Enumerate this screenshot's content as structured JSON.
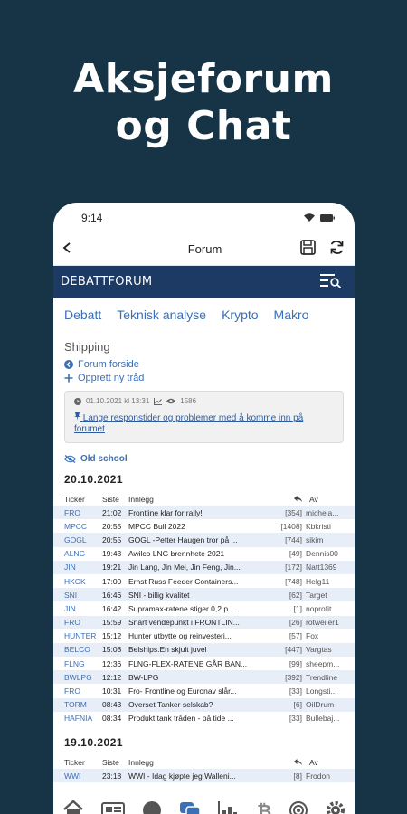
{
  "headline": {
    "line1": "Aksjeforum",
    "line2": "og Chat"
  },
  "status": {
    "time": "9:14"
  },
  "appbar": {
    "title": "Forum"
  },
  "banner": {
    "title": "DEBATTFORUM"
  },
  "tabs": [
    "Debatt",
    "Teknisk analyse",
    "Krypto",
    "Makro"
  ],
  "section": {
    "title": "Shipping",
    "forum_home": "Forum forside",
    "new_thread": "Opprett ny tråd"
  },
  "notice": {
    "date": "01.10.2021 kl 13:31",
    "views": "1586",
    "link": "Lange responstider og problemer med å komme inn på forumet"
  },
  "oldschool": {
    "label": "Old school"
  },
  "columns": {
    "ticker": "Ticker",
    "last": "Siste",
    "post": "Innlegg",
    "by": "Av"
  },
  "groups": [
    {
      "date": "20.10.2021",
      "rows": [
        {
          "ticker": "FRO",
          "time": "21:02",
          "post": "Frontline klar for rally!",
          "count": "[354]",
          "author": "michela..."
        },
        {
          "ticker": "MPCC",
          "time": "20:55",
          "post": "MPCC Bull 2022",
          "count": "[1408]",
          "author": "Kbkristi"
        },
        {
          "ticker": "GOGL",
          "time": "20:55",
          "post": "GOGL -Petter Haugen tror på ...",
          "count": "[744]",
          "author": "sikim"
        },
        {
          "ticker": "ALNG",
          "time": "19:43",
          "post": "Awilco LNG brennhete 2021",
          "count": "[49]",
          "author": "Dennis00"
        },
        {
          "ticker": "JIN",
          "time": "19:21",
          "post": "Jin Lang, Jin Mei, Jin Feng, Jin...",
          "count": "[172]",
          "author": "Natt1369"
        },
        {
          "ticker": "HKCK",
          "time": "17:00",
          "post": "Ernst Russ Feeder Containers...",
          "count": "[748]",
          "author": "Helg11"
        },
        {
          "ticker": "SNI",
          "time": "16:46",
          "post": "SNI - billig kvalitet",
          "count": "[62]",
          "author": "Target"
        },
        {
          "ticker": "JIN",
          "time": "16:42",
          "post": "Supramax-ratene stiger 0,2 p...",
          "count": "[1]",
          "author": "noprofit"
        },
        {
          "ticker": "FRO",
          "time": "15:59",
          "post": "Snart vendepunkt i FRONTLIN...",
          "count": "[26]",
          "author": "rotweiler1"
        },
        {
          "ticker": "HUNTER",
          "time": "15:12",
          "post": "Hunter utbytte og reinvesteri...",
          "count": "[57]",
          "author": "Fox"
        },
        {
          "ticker": "BELCO",
          "time": "15:08",
          "post": "Belships.En skjult juvel",
          "count": "[447]",
          "author": "Vargtas"
        },
        {
          "ticker": "FLNG",
          "time": "12:36",
          "post": "FLNG-FLEX-RATENE GÅR BAN...",
          "count": "[99]",
          "author": "sheepm..."
        },
        {
          "ticker": "BWLPG",
          "time": "12:12",
          "post": "BW-LPG",
          "count": "[392]",
          "author": "Trendline"
        },
        {
          "ticker": "FRO",
          "time": "10:31",
          "post": "Fro- Frontline og Euronav slår...",
          "count": "[33]",
          "author": "Longsti..."
        },
        {
          "ticker": "TORM",
          "time": "08:43",
          "post": "Overset Tanker selskab?",
          "count": "[6]",
          "author": "OilDrum"
        },
        {
          "ticker": "HAFNIA",
          "time": "08:34",
          "post": "Produkt tank tråden - på tide ...",
          "count": "[33]",
          "author": "Bullebaj..."
        }
      ]
    },
    {
      "date": "19.10.2021",
      "rows": [
        {
          "ticker": "WWI",
          "time": "23:18",
          "post": "WWI - Idag kjøpte jeg Walleni...",
          "count": "[8]",
          "author": "Frodon"
        }
      ]
    }
  ],
  "colors": {
    "background": "#173447",
    "banner": "#1d3a64",
    "accent": "#3b6fb6",
    "highlight": "#e8eef8"
  },
  "icons": [
    "back-arrow-icon",
    "save-icon",
    "refresh-icon",
    "search-list-icon",
    "circle-arrow-left-icon",
    "plus-icon",
    "clock-icon",
    "chart-icon",
    "eye-icon",
    "pin-icon",
    "eye-slash-icon",
    "reply-icon",
    "home-icon",
    "news-icon",
    "chat-bubble-icon",
    "forum-icon",
    "stats-icon",
    "bitcoin-icon",
    "radio-icon",
    "gear-icon"
  ]
}
